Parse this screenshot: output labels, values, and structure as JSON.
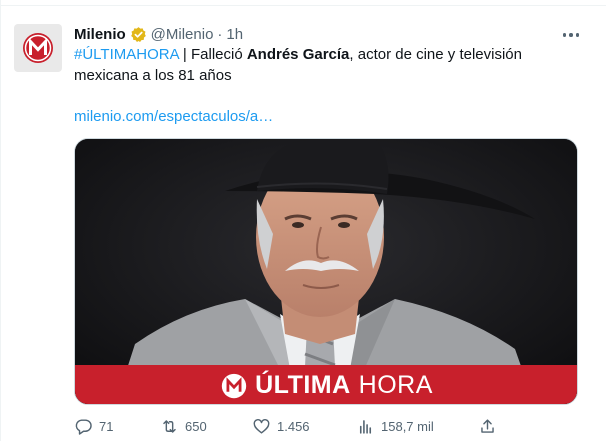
{
  "tweet": {
    "author_name": "Milenio",
    "handle": "@Milenio",
    "separator": "·",
    "time": "1h",
    "text": {
      "hashtag": "#ÚLTIMAHORA",
      "part1": " | Falleció ",
      "bold_name": "Andrés García",
      "part2": ", actor de cine y televisión mexicana a los 81 años"
    },
    "link": "milenio.com/espectaculos/a…",
    "media": {
      "banner_bold": "ÚLTIMA",
      "banner_light": "HORA",
      "logo_letter": "M"
    },
    "stats": {
      "replies": "71",
      "retweets": "650",
      "likes": "1.456",
      "views": "158,7 mil"
    }
  },
  "icons": [
    "verified-badge-icon",
    "more-icon",
    "reply-icon",
    "retweet-icon",
    "like-icon",
    "views-icon",
    "share-icon"
  ],
  "colors": {
    "link": "#1d9bf0",
    "brand_red": "#c8202c",
    "verified_gold": "#e2b719",
    "muted": "#536471"
  }
}
